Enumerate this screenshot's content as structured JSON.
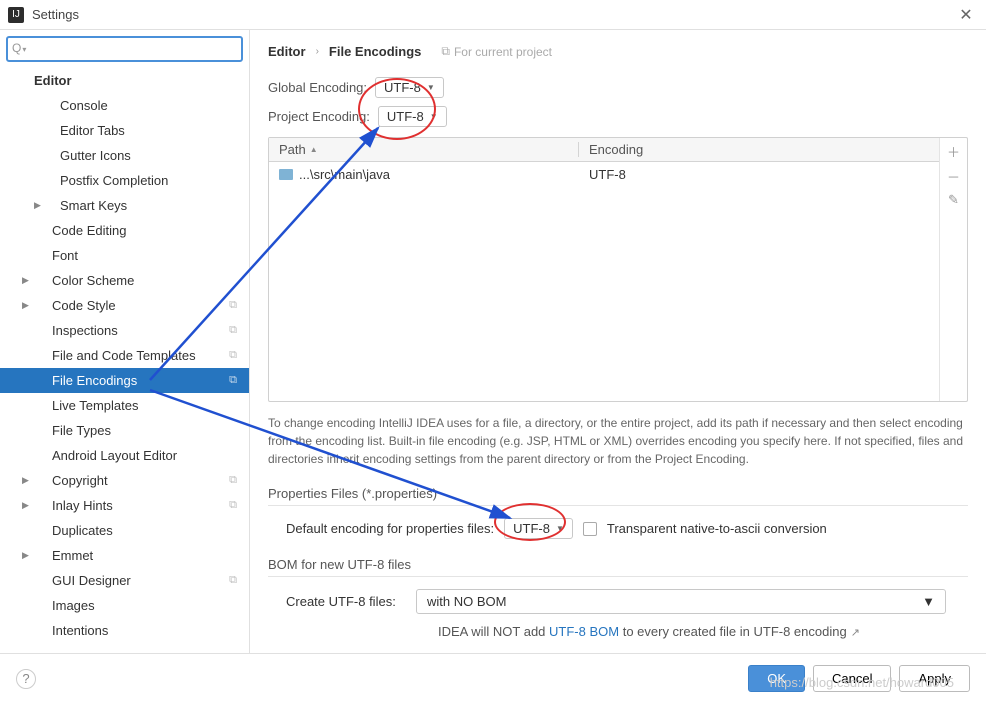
{
  "window": {
    "title": "Settings"
  },
  "search": {
    "placeholder": ""
  },
  "sidebar": {
    "items": [
      {
        "label": "Editor",
        "bold": true,
        "level": 0
      },
      {
        "label": "Console",
        "level": 2
      },
      {
        "label": "Editor Tabs",
        "level": 2
      },
      {
        "label": "Gutter Icons",
        "level": 2
      },
      {
        "label": "Postfix Completion",
        "level": 2
      },
      {
        "label": "Smart Keys",
        "level": 2,
        "arrow": true
      },
      {
        "label": "Code Editing",
        "level": 1
      },
      {
        "label": "Font",
        "level": 1
      },
      {
        "label": "Color Scheme",
        "level": 1,
        "arrow": true,
        "arrowLeft": true
      },
      {
        "label": "Code Style",
        "level": 1,
        "arrow": true,
        "arrowLeft": true,
        "copy": true
      },
      {
        "label": "Inspections",
        "level": 1,
        "copy": true
      },
      {
        "label": "File and Code Templates",
        "level": 1,
        "copy": true
      },
      {
        "label": "File Encodings",
        "level": 1,
        "copy": true,
        "selected": true
      },
      {
        "label": "Live Templates",
        "level": 1
      },
      {
        "label": "File Types",
        "level": 1
      },
      {
        "label": "Android Layout Editor",
        "level": 1
      },
      {
        "label": "Copyright",
        "level": 1,
        "arrow": true,
        "arrowLeft": true,
        "copy": true
      },
      {
        "label": "Inlay Hints",
        "level": 1,
        "arrow": true,
        "arrowLeft": true,
        "copy": true
      },
      {
        "label": "Duplicates",
        "level": 1
      },
      {
        "label": "Emmet",
        "level": 1,
        "arrow": true,
        "arrowLeft": true
      },
      {
        "label": "GUI Designer",
        "level": 1,
        "copy": true
      },
      {
        "label": "Images",
        "level": 1
      },
      {
        "label": "Intentions",
        "level": 1
      }
    ]
  },
  "breadcrumb": {
    "root": "Editor",
    "leaf": "File Encodings",
    "badge": "For current project"
  },
  "settings": {
    "globalEncodingLabel": "Global Encoding:",
    "globalEncoding": "UTF-8",
    "projectEncodingLabel": "Project Encoding:",
    "projectEncoding": "UTF-8"
  },
  "table": {
    "cols": {
      "path": "Path",
      "encoding": "Encoding"
    },
    "rows": [
      {
        "path": "...\\src\\main\\java",
        "encoding": "UTF-8"
      }
    ]
  },
  "helpText": "To change encoding IntelliJ IDEA uses for a file, a directory, or the entire project, add its path if necessary and then select encoding from the encoding list. Built-in file encoding (e.g. JSP, HTML or XML) overrides encoding you specify here. If not specified, files and directories inherit encoding settings from the parent directory or from the Project Encoding.",
  "propsSection": {
    "title": "Properties Files (*.properties)",
    "label": "Default encoding for properties files:",
    "value": "UTF-8",
    "checkboxLabel": "Transparent native-to-ascii conversion"
  },
  "bomSection": {
    "title": "BOM for new UTF-8 files",
    "label": "Create UTF-8 files:",
    "value": "with NO BOM",
    "note1": "IDEA will NOT add ",
    "noteLink": "UTF-8 BOM",
    "note2": " to every created file in UTF-8 encoding"
  },
  "footer": {
    "ok": "OK",
    "cancel": "Cancel",
    "apply": "Apply"
  },
  "watermark": "https://blog.csdn.net/howard005"
}
